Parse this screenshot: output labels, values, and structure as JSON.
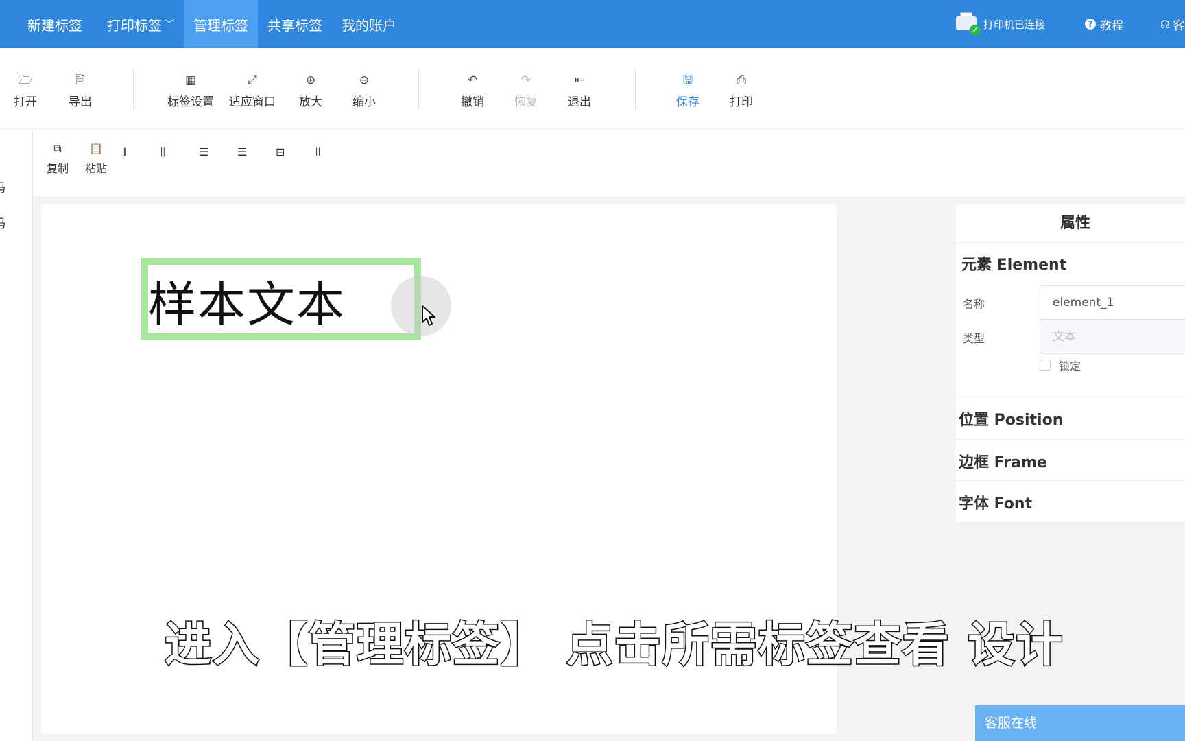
{
  "nav": {
    "items": [
      {
        "label": "新建标签"
      },
      {
        "label": "打印标签",
        "chevron": "﹀"
      },
      {
        "label": "管理标签"
      },
      {
        "label": "共享标签"
      },
      {
        "label": "我的账户"
      }
    ],
    "printer_status": "打印机已连接",
    "tutorial": "教程",
    "service": "客"
  },
  "toolbar": {
    "open": "打开",
    "export": "导出",
    "label_settings": "标签设置",
    "fit_window": "适应窗口",
    "zoom_in": "放大",
    "zoom_out": "缩小",
    "undo": "撤销",
    "redo": "恢复",
    "exit": "退出",
    "save": "保存",
    "print": "打印"
  },
  "toolbar2": {
    "copy": "复制",
    "paste": "粘贴"
  },
  "left_strip": {
    "frag1": "码",
    "frag2": "码"
  },
  "canvas": {
    "sample_text": "样本文本"
  },
  "props": {
    "title": "属性",
    "element_section": "元素 Element",
    "name_label": "名称",
    "name_value": "element_1",
    "type_label": "类型",
    "type_value": "文本",
    "lock_label": "锁定",
    "position_section": "位置 Position",
    "frame_section": "边框 Frame",
    "font_section": "字体 Font"
  },
  "caption": "进入【管理标签】 点击所需标签查看 设计",
  "service_bottom": "客服在线",
  "colors": {
    "nav_bg": "#2e86de",
    "nav_active": "#4da0f0",
    "selection_border": "#a8e6a0",
    "primary": "#3a8ee6",
    "service_bg": "#69b1f0"
  }
}
